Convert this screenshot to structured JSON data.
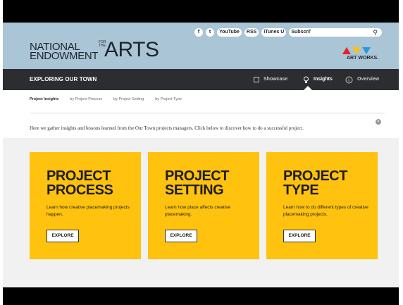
{
  "logo": {
    "line1": "NATIONAL",
    "line2": "ENDOWMENT",
    "vertical": "FOR THE",
    "big": "ARTS"
  },
  "social": {
    "facebook": "f",
    "twitter": "t",
    "youtube": "YouTube",
    "rss": "RSS",
    "itunes": "iTunes U",
    "subscribe": "Subscribe"
  },
  "search": {
    "placeholder": ""
  },
  "art_works": {
    "label": "ART WORKS.",
    "colors": [
      "#e32128",
      "#ffc20e",
      "#2a9ad6"
    ]
  },
  "nav": {
    "title": "EXPLORING OUR TOWN",
    "items": [
      {
        "label": "Showcase",
        "icon": "showcase-icon"
      },
      {
        "label": "Insights",
        "icon": "lightbulb-icon",
        "active": true
      },
      {
        "label": "Overview",
        "icon": "info-icon"
      }
    ]
  },
  "subtabs": [
    "Project Insights",
    "by Project Process",
    "by Project Setting",
    "by Project Type"
  ],
  "intro": "Here we gather insights and lessons learned from the Our Town projects managers. Click below to discover how to do a successful project.",
  "cards": [
    {
      "title": "PROJECT\nPROCESS",
      "desc": "Learn how creative placemaking projects happen.",
      "button": "EXPLORE"
    },
    {
      "title": "PROJECT\nSETTING",
      "desc": "Learn how place affects creative placemaking.",
      "button": "EXPLORE"
    },
    {
      "title": "PROJECT\nTYPE",
      "desc": "Learn how to do different types of creative placemaking projects.",
      "button": "EXPLORE"
    }
  ],
  "colors": {
    "accent": "#ffc20e",
    "nav_bg": "#2b2d31",
    "header_bg": "#a9c5d6"
  }
}
